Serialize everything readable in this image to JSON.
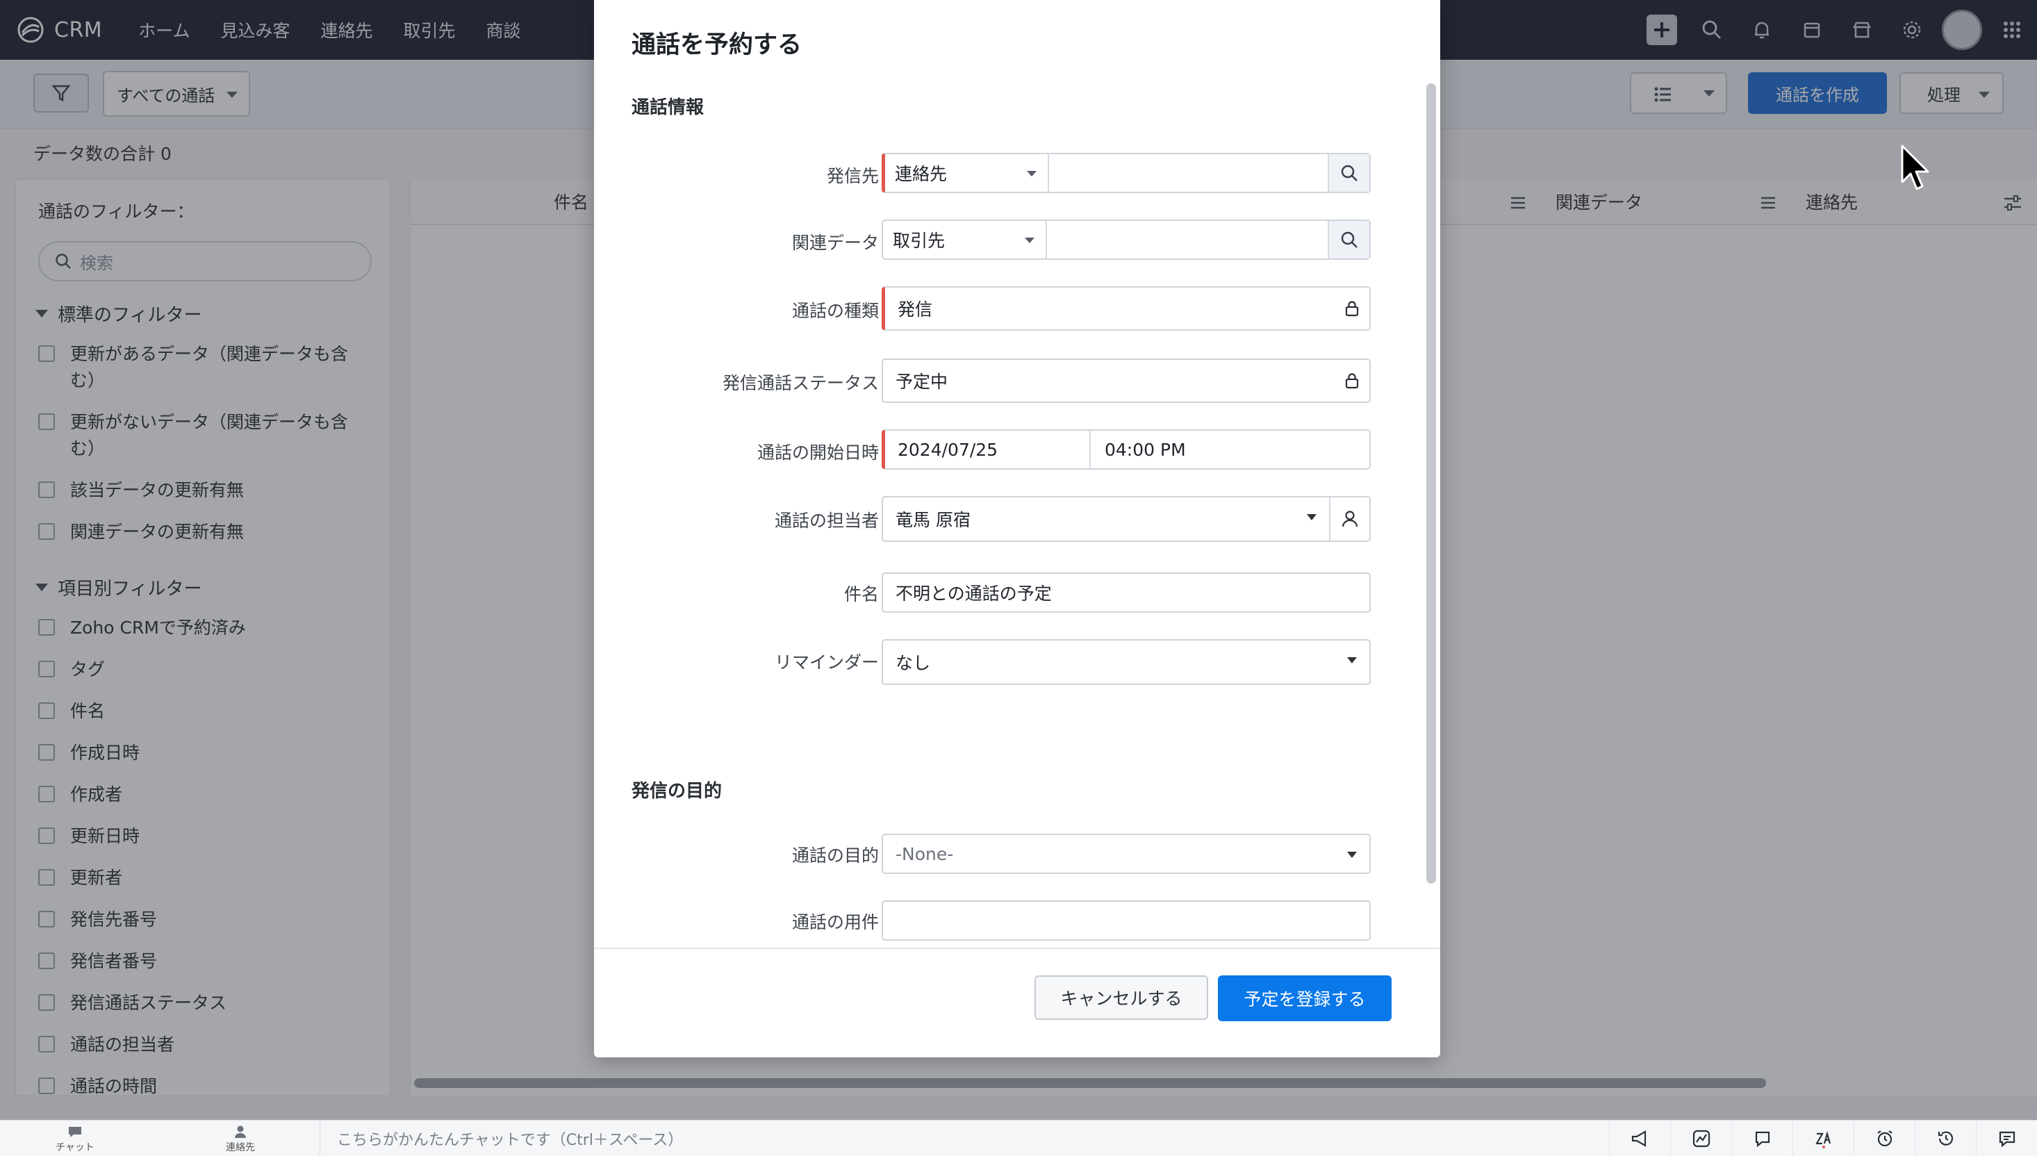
{
  "app": {
    "name": "CRM"
  },
  "nav": {
    "tabs": [
      "ホーム",
      "見込み客",
      "連絡先",
      "取引先",
      "商談"
    ]
  },
  "toolbar": {
    "view_label": "すべての通話",
    "create_label": "通話を作成",
    "action_label": "処理",
    "total_label": "データ数の合計",
    "total_count": "0"
  },
  "filters": {
    "title": "通話のフィルター：",
    "search_placeholder": "検索",
    "standard_title": "標準のフィルター",
    "standard_items": [
      "更新があるデータ（関連データも含む）",
      "更新がないデータ（関連データも含む）",
      "該当データの更新有無",
      "関連データの更新有無"
    ],
    "field_title": "項目別フィルター",
    "field_items": [
      "Zoho CRMで予約済み",
      "タグ",
      "件名",
      "作成日時",
      "作成者",
      "更新日時",
      "更新者",
      "発信先番号",
      "発信者番号",
      "発信通話ステータス",
      "通話の担当者",
      "通話の時間"
    ]
  },
  "table": {
    "columns": [
      "件名",
      "関連データ",
      "連絡先"
    ]
  },
  "modal": {
    "title": "通話を予約する",
    "section1": "通話情報",
    "section2": "発信の目的",
    "fields": {
      "callee": {
        "label": "発信先",
        "module": "連絡先"
      },
      "related": {
        "label": "関連データ",
        "module": "取引先"
      },
      "call_type": {
        "label": "通話の種類",
        "value": "発信"
      },
      "status": {
        "label": "発信通話ステータス",
        "value": "予定中"
      },
      "start": {
        "label": "通話の開始日時",
        "date": "2024/07/25",
        "time": "04:00 PM"
      },
      "owner": {
        "label": "通話の担当者",
        "value": "竜馬 原宿"
      },
      "subject": {
        "label": "件名",
        "value": "不明との通話の予定"
      },
      "reminder": {
        "label": "リマインダー",
        "value": "なし"
      },
      "purpose": {
        "label": "通話の目的",
        "value": "-None-"
      },
      "agenda": {
        "label": "通話の用件",
        "value": ""
      }
    },
    "cancel_label": "キャンセルする",
    "submit_label": "予定を登録する"
  },
  "bottombar": {
    "chat_label": "チャット",
    "contacts_label": "連絡先",
    "chat_placeholder": "こちらがかんたんチャットです（Ctrl＋スペース）"
  }
}
